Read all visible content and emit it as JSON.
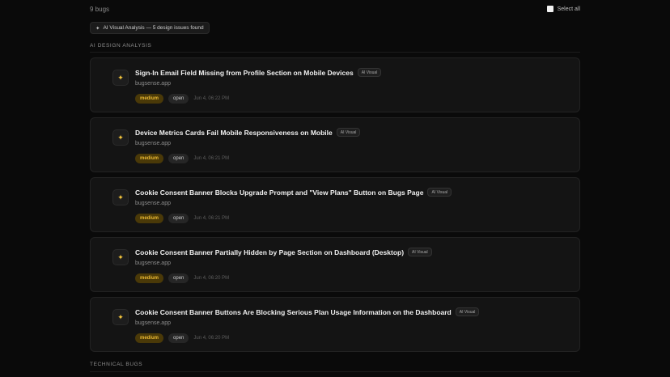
{
  "header": {
    "bug_count": "9 bugs",
    "select_all_label": "Select all"
  },
  "ai_chip": {
    "icon": "sparkle-icon",
    "label": "AI Visual Analysis — 5 design issues found"
  },
  "sections": {
    "ai_design": "AI DESIGN ANALYSIS",
    "technical": "TECHNICAL BUGS"
  },
  "colors": {
    "severity_bg": "#4a3908",
    "severity_text": "#e9b833",
    "sparkle": "#f2c43d",
    "background": "#0a0a0a",
    "card": "#141414"
  },
  "bugs": [
    {
      "title": "Sign-In Email Field Missing from Profile Section on Mobile Devices",
      "badge": "AI Visual",
      "domain": "bugsense.app",
      "severity": "medium",
      "status": "open",
      "time": "Jun 4, 06:22 PM"
    },
    {
      "title": "Device Metrics Cards Fail Mobile Responsiveness on Mobile",
      "badge": "AI Visual",
      "domain": "bugsense.app",
      "severity": "medium",
      "status": "open",
      "time": "Jun 4, 06:21 PM"
    },
    {
      "title": "Cookie Consent Banner Blocks Upgrade Prompt and \"View Plans\" Button on Bugs Page",
      "badge": "AI Visual",
      "domain": "bugsense.app",
      "severity": "medium",
      "status": "open",
      "time": "Jun 4, 06:21 PM"
    },
    {
      "title": "Cookie Consent Banner Partially Hidden by Page Section on Dashboard (Desktop)",
      "badge": "AI Visual",
      "domain": "bugsense.app",
      "severity": "medium",
      "status": "open",
      "time": "Jun 4, 06:20 PM"
    },
    {
      "title": "Cookie Consent Banner Buttons Are Blocking Serious Plan Usage Information on the Dashboard",
      "badge": "AI Visual",
      "domain": "bugsense.app",
      "severity": "medium",
      "status": "open",
      "time": "Jun 4, 06:20 PM"
    }
  ]
}
